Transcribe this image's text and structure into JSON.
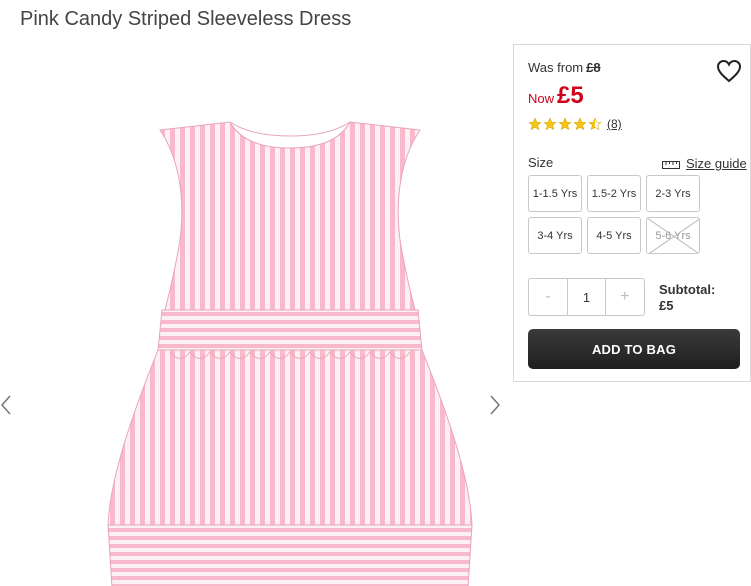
{
  "product": {
    "title": "Pink Candy Striped Sleeveless Dress",
    "image_alt": "pink-white-striped-dress-image"
  },
  "price": {
    "was_label": "Was from",
    "was_value": "£8",
    "now_label": "Now",
    "now_value": "£5"
  },
  "rating": {
    "stars": 4.5,
    "review_count": "(8)"
  },
  "size": {
    "label": "Size",
    "guide_label": "Size guide",
    "options": [
      {
        "label": "1-1.5 Yrs",
        "available": true
      },
      {
        "label": "1.5-2 Yrs",
        "available": true
      },
      {
        "label": "2-3 Yrs",
        "available": true
      },
      {
        "label": "3-4 Yrs",
        "available": true
      },
      {
        "label": "4-5 Yrs",
        "available": true
      },
      {
        "label": "5-6 Yrs",
        "available": false
      }
    ]
  },
  "quantity": {
    "minus": "-",
    "value": "1",
    "plus": "+"
  },
  "subtotal": {
    "label": "Subtotal:",
    "value": "£5"
  },
  "cta": {
    "add_to_bag": "ADD TO BAG"
  },
  "colors": {
    "sale_red": "#d0021b",
    "star_gold": "#f5c518",
    "button_dark": "#2b2b2b",
    "dress_pink": "#f5b8c9"
  },
  "icons": {
    "wishlist": "heart-outline-icon",
    "size_guide": "ruler-icon",
    "prev": "chevron-left-icon",
    "next": "chevron-right-icon"
  }
}
